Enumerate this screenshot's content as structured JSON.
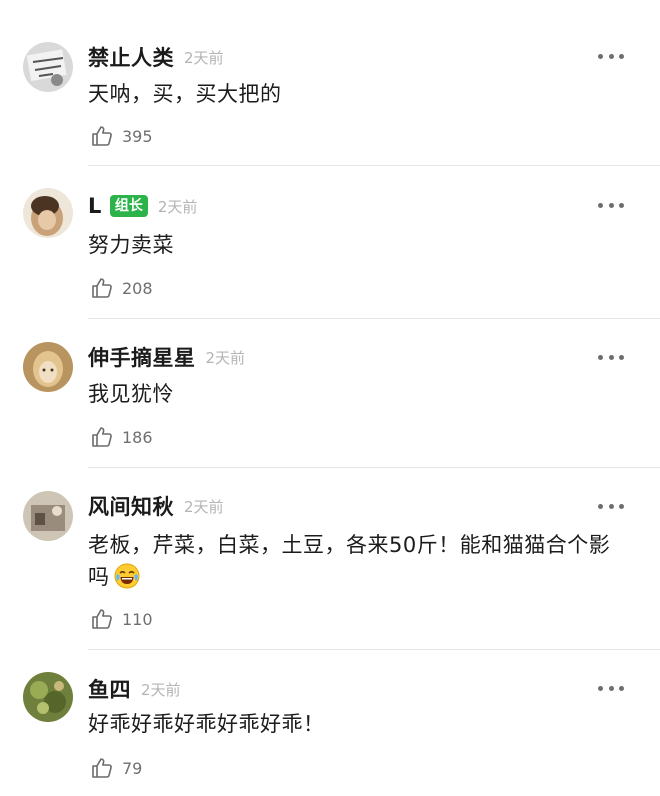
{
  "comments": [
    {
      "username": "禁止人类",
      "badge": "",
      "time": "2天前",
      "content": "天呐，买，买大把的",
      "likes": "395",
      "avatar_color": "#c9c9c9"
    },
    {
      "username": "L",
      "badge": "组长",
      "time": "2天前",
      "content": "努力卖菜",
      "likes": "208",
      "avatar_color": "#d8c3a8"
    },
    {
      "username": "伸手摘星星",
      "badge": "",
      "time": "2天前",
      "content": "我见犹怜",
      "likes": "186",
      "avatar_color": "#caa56e"
    },
    {
      "username": "风间知秋",
      "badge": "",
      "time": "2天前",
      "content": "老板，芹菜，白菜，土豆，各来50斤！能和猫猫合个影吗",
      "likes": "110",
      "avatar_color": "#b8ac9d"
    },
    {
      "username": "鱼四",
      "badge": "",
      "time": "2天前",
      "content": "好乖好乖好乖好乖好乖！",
      "likes": "79",
      "avatar_color": "#7a8a45"
    }
  ],
  "icons": {
    "more": "more-dots-icon",
    "like": "thumbs-up-icon",
    "emoji": "laughing-crying-emoji"
  },
  "colors": {
    "badge_green": "#2cb34a",
    "timestamp_gray": "#b4b4b4",
    "divider": "#e6e6e6"
  }
}
